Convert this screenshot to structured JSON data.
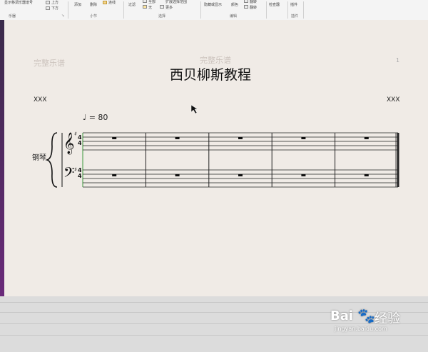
{
  "ribbon": {
    "groups": [
      {
        "name": "乐器",
        "items": [
          "显示移调乐器谱号",
          "上方",
          "下方"
        ]
      },
      {
        "name": "小节",
        "items": [
          "添加",
          "删除",
          "连线"
        ]
      },
      {
        "name": "选择",
        "items": [
          "过滤",
          "全部",
          "无",
          "更多",
          "扩展选择范围"
        ]
      },
      {
        "name": "编辑",
        "items": [
          "隐藏或显示",
          "颜色",
          "翻转",
          "翻转"
        ]
      },
      {
        "name": "",
        "items": [
          "检查器"
        ]
      },
      {
        "name": "插件",
        "items": [
          "插件"
        ]
      }
    ]
  },
  "score": {
    "watermark": "完整乐谱",
    "title": "西贝柳斯教程",
    "composer_left": "XXX",
    "composer_right": "XXX",
    "page_number": "1",
    "tempo_value": "= 80",
    "instrument": "钢琴",
    "measures": 5,
    "treble_clef": "𝄞",
    "bass_clef": "𝄢"
  },
  "watermark_logo": {
    "brand": "Bai",
    "paw": "du",
    "suffix": "经验",
    "url": "jingyan.baidu.com"
  },
  "colors": {
    "ribbon": "#f4f4f4",
    "canvas": "#f0ebe6",
    "left_bar": "#5b2a6a"
  }
}
